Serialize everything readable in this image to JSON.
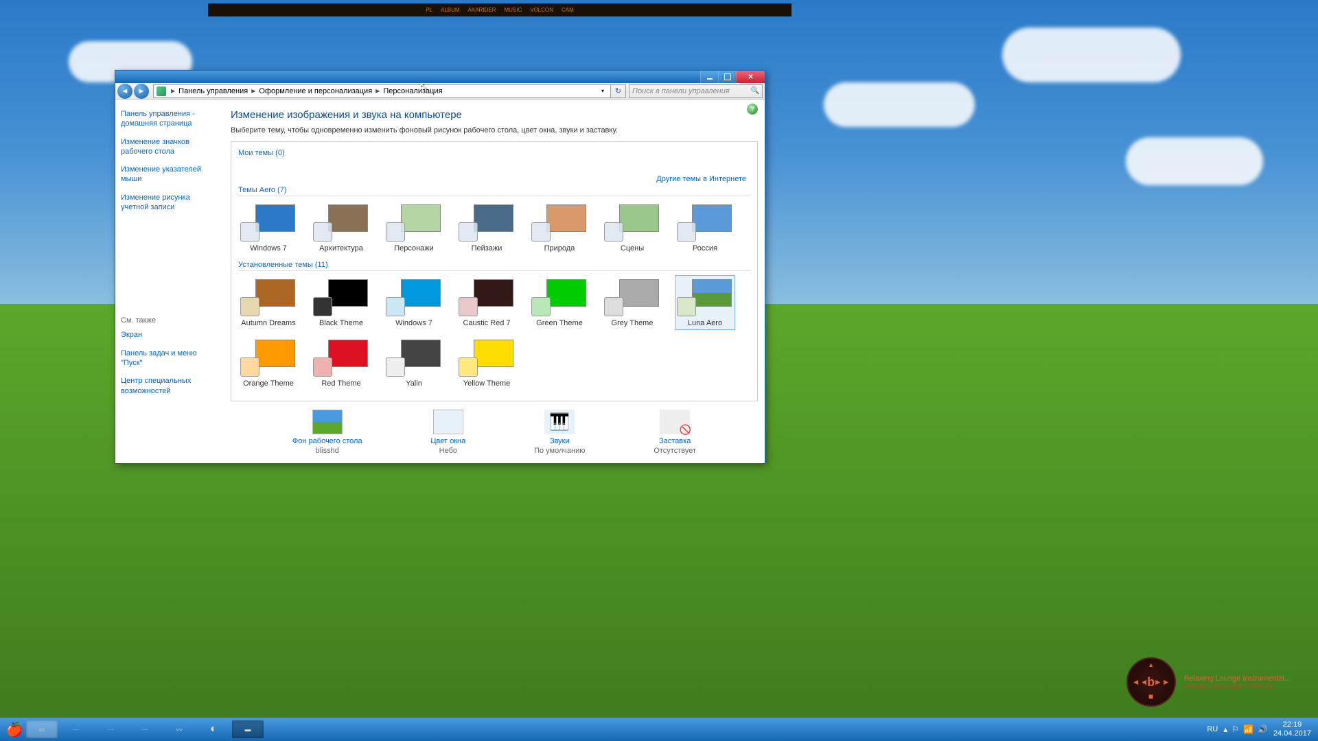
{
  "toolbar": {
    "items": [
      "PL",
      "ALBUM",
      "AKARIDER",
      "MUSIC",
      "VOLCON",
      "CAM"
    ]
  },
  "window": {
    "breadcrumbs": [
      "Панель управления",
      "Оформление и персонализация",
      "Персонализация"
    ],
    "search_placeholder": "Поиск в панели управления"
  },
  "sidebar": {
    "links": [
      "Панель управления - домашняя страница",
      "Изменение значков рабочего стола",
      "Изменение указателей мыши",
      "Изменение рисунка учетной записи"
    ],
    "see_also_title": "См. также",
    "see_also": [
      "Экран",
      "Панель задач и меню \"Пуск\"",
      "Центр специальных возможностей"
    ]
  },
  "main": {
    "title": "Изменение изображения и звука на компьютере",
    "subtitle": "Выберите тему, чтобы одновременно изменить фоновый рисунок рабочего стола, цвет окна, звуки и заставку.",
    "my_themes_header": "Мои темы (0)",
    "online_link": "Другие темы в Интернете",
    "aero_header": "Темы Aero (7)",
    "aero_themes": [
      {
        "label": "Windows 7",
        "color": "#2a7ac8"
      },
      {
        "label": "Архитектура",
        "color": "#8a7055"
      },
      {
        "label": "Персонажи",
        "color": "#b5d5a5"
      },
      {
        "label": "Пейзажи",
        "color": "#4a6a8a"
      },
      {
        "label": "Природа",
        "color": "#d89868"
      },
      {
        "label": "Сцены",
        "color": "#9ac888"
      },
      {
        "label": "Россия",
        "color": "#5a9ad8"
      }
    ],
    "installed_header": "Установленные темы (11)",
    "installed_themes": [
      {
        "label": "Autumn Dreams",
        "color": "#aa6622",
        "swatch": "#e8d8b0"
      },
      {
        "label": "Black Theme",
        "color": "#000000",
        "swatch": "#333"
      },
      {
        "label": "Windows 7",
        "color": "#0099dd",
        "swatch": "#cce8f5"
      },
      {
        "label": "Caustic Red 7",
        "color": "#331818",
        "swatch": "#e8c8c8"
      },
      {
        "label": "Green Theme",
        "color": "#00cc00",
        "swatch": "#b8e8b8"
      },
      {
        "label": "Grey Theme",
        "color": "#aaaaaa",
        "swatch": "#ddd"
      },
      {
        "label": "Luna Aero",
        "color": "#5a9a3a",
        "swatch": "#d8e8c8",
        "selected": true
      },
      {
        "label": "Orange Theme",
        "color": "#ff9900",
        "swatch": "#ffd8a0"
      },
      {
        "label": "Red Theme",
        "color": "#dd1122",
        "swatch": "#f0b0b0"
      },
      {
        "label": "Yalin",
        "color": "#444444",
        "swatch": "#eee"
      },
      {
        "label": "Yellow Theme",
        "color": "#ffdd00",
        "swatch": "#ffe880"
      }
    ],
    "bottom": [
      {
        "title": "Фон рабочего стола",
        "value": "blisshd",
        "kind": "bliss"
      },
      {
        "title": "Цвет окна",
        "value": "Небо",
        "kind": "color"
      },
      {
        "title": "Звуки",
        "value": "По умолчанию",
        "kind": "sounds"
      },
      {
        "title": "Заставка",
        "value": "Отсутствует",
        "kind": "saver"
      }
    ]
  },
  "music": {
    "title": "Relaxing Lounge Instrumental...",
    "url": "youtube.com/watch?v=koLYq..."
  },
  "tray": {
    "lang": "RU",
    "time": "22:19",
    "date": "24.04.2017"
  }
}
